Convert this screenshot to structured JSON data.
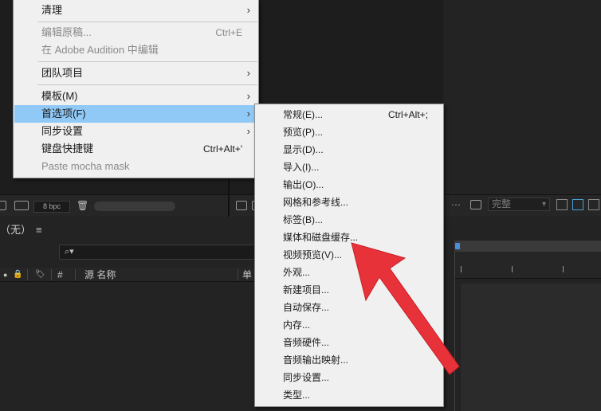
{
  "context_menu": {
    "items": [
      {
        "label": "清理",
        "shortcut": "",
        "submenu": true,
        "disabled": false
      },
      {
        "label": "编辑原稿...",
        "shortcut": "Ctrl+E",
        "submenu": false,
        "disabled": true
      },
      {
        "label": "在 Adobe Audition 中编辑",
        "shortcut": "",
        "submenu": false,
        "disabled": true
      },
      {
        "label": "团队项目",
        "shortcut": "",
        "submenu": true,
        "disabled": false
      },
      {
        "label": "模板(M)",
        "shortcut": "",
        "submenu": true,
        "disabled": false
      },
      {
        "label": "首选项(F)",
        "shortcut": "",
        "submenu": true,
        "disabled": false,
        "highlighted": true
      },
      {
        "label": "同步设置",
        "shortcut": "",
        "submenu": true,
        "disabled": false
      },
      {
        "label": "键盘快捷键",
        "shortcut": "Ctrl+Alt+'",
        "submenu": false,
        "disabled": false
      },
      {
        "label": "Paste mocha mask",
        "shortcut": "",
        "submenu": false,
        "disabled": true
      }
    ],
    "arrow_glyph": "›",
    "highlight_color": "#90c8f6"
  },
  "preferences_submenu": {
    "items": [
      {
        "label": "常规(E)...",
        "shortcut": "Ctrl+Alt+;"
      },
      {
        "label": "预览(P)..."
      },
      {
        "label": "显示(D)..."
      },
      {
        "label": "导入(I)..."
      },
      {
        "label": "输出(O)..."
      },
      {
        "label": "网格和参考线..."
      },
      {
        "label": "标签(B)..."
      },
      {
        "label": "媒体和磁盘缓存..."
      },
      {
        "label": "视频预览(V)..."
      },
      {
        "label": "外观..."
      },
      {
        "label": "新建项目..."
      },
      {
        "label": "自动保存..."
      },
      {
        "label": "内存..."
      },
      {
        "label": "音频硬件..."
      },
      {
        "label": "音频输出映射..."
      },
      {
        "label": "同步设置..."
      },
      {
        "label": "类型..."
      }
    ]
  },
  "toolbar": {
    "bpc_label": "8 bpc",
    "quality_label": "完整",
    "trash_glyph": "🗑",
    "dots_glyph": "⋯"
  },
  "project_panel": {
    "tab_label": "（无）",
    "menu_glyph": "≡",
    "search_glyph": "⌕▾",
    "columns": {
      "dot": "●",
      "lock": "🔒",
      "tag": "🏷",
      "number": "#",
      "source_name": "源 名称",
      "single": "单"
    }
  },
  "annotation": {
    "arrow_color": "#e8323a",
    "points_to": "媒体和磁盘缓存..."
  }
}
